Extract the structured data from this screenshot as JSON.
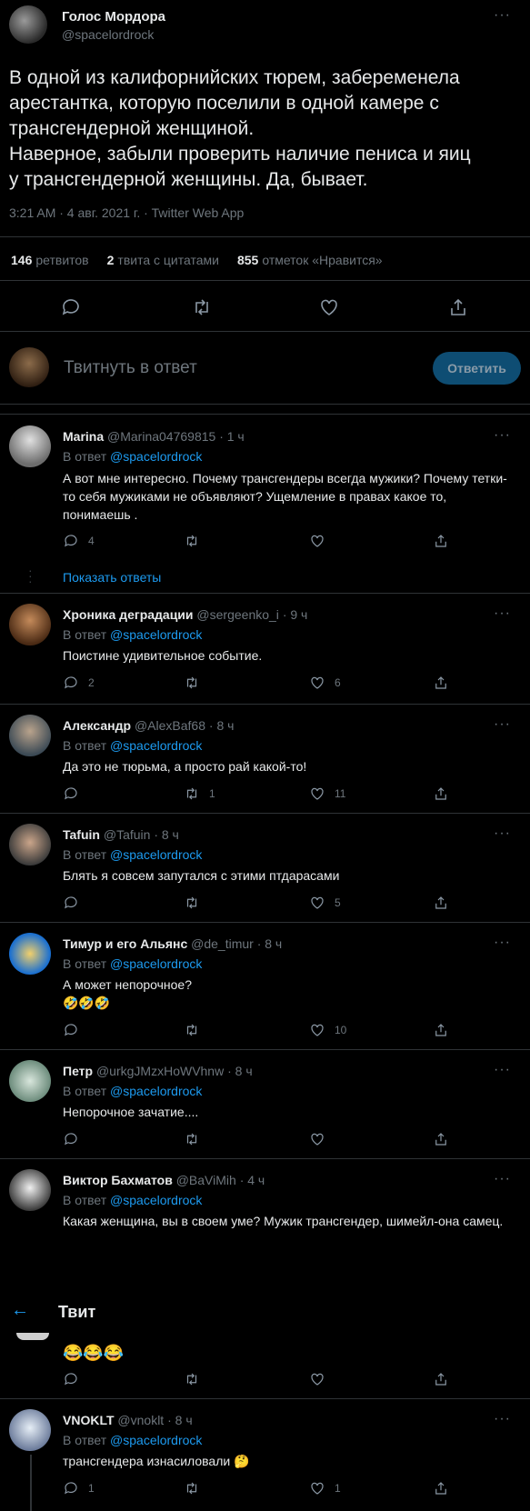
{
  "main_tweet": {
    "name": "Голос Мордора",
    "handle": "@spacelordrock",
    "more": "···",
    "text_lines": [
      "В одной из калифорнийских тюрем, забеременела",
      "арестантка, которую поселили в одной камере с",
      "трансгендерной женщиной.",
      "Наверное, забыли проверить наличие пениса и яиц",
      "у трансгендерной женщины. Да, бывает."
    ],
    "meta": "3:21 AM · 4 авг. 2021 г. · Twitter Web App",
    "stats": [
      {
        "count": "146",
        "label": "ретвитов"
      },
      {
        "count": "2",
        "label": "твита с цитатами"
      },
      {
        "count": "855",
        "label": "отметок «Нравится»"
      }
    ]
  },
  "reply_box": {
    "placeholder": "Твитнуть в ответ",
    "button": "Ответить"
  },
  "header": {
    "back_icon": "arrow-left-icon",
    "title": "Твит"
  },
  "replies": [
    {
      "name": "Marina",
      "handle": "@Marina04769815",
      "time": "· 1 ч",
      "in_reply_prefix": "В ответ",
      "in_reply_to": "@spacelordrock",
      "text": "А вот мне интересно. Почему трансгендеры всегда мужики? Почему тетки-то себя мужиками не объявляют? Ущемление в правах какое то, понимаешь .",
      "replies": "4",
      "retweets": "",
      "likes": "",
      "show_replies": "Показать ответы"
    },
    {
      "name": "Хроника деградации",
      "handle": "@sergeenko_i",
      "time": "· 9 ч",
      "in_reply_prefix": "В ответ",
      "in_reply_to": "@spacelordrock",
      "text": "Поистине удивительное событие.",
      "replies": "2",
      "retweets": "",
      "likes": "6"
    },
    {
      "name": "Александр",
      "handle": "@AlexBaf68",
      "time": "· 8 ч",
      "in_reply_prefix": "В ответ",
      "in_reply_to": "@spacelordrock",
      "text": "Да это не тюрьма, а просто рай какой-то!",
      "replies": "",
      "retweets": "1",
      "likes": "11"
    },
    {
      "name": "Tafuin",
      "handle": "@Tafuin",
      "time": "· 8 ч",
      "in_reply_prefix": "В ответ",
      "in_reply_to": "@spacelordrock",
      "text": "Блять я совсем запутался с этими птдарасами",
      "replies": "",
      "retweets": "",
      "likes": "5"
    },
    {
      "name": "Тимур и его Альянс",
      "handle": "@de_timur",
      "time": "· 8 ч",
      "in_reply_prefix": "В ответ",
      "in_reply_to": "@spacelordrock",
      "text": "А может непорочное?",
      "emoji": "🤣🤣🤣",
      "replies": "",
      "retweets": "",
      "likes": "10"
    },
    {
      "name": "Петр",
      "handle": "@urkgJMzxHoWVhnw",
      "time": "· 8 ч",
      "in_reply_prefix": "В ответ",
      "in_reply_to": "@spacelordrock",
      "text": "Непорочное зачатие....",
      "replies": "",
      "retweets": "",
      "likes": ""
    },
    {
      "name": "Виктор Бахматов",
      "handle": "@BaViMih",
      "time": "· 4 ч",
      "in_reply_prefix": "В ответ",
      "in_reply_to": "@spacelordrock",
      "text": "Какая женщина, вы в своем уме? Мужик трансгендер, шимейл-она самец."
    },
    {
      "partial_emoji": "😂😂😂",
      "replies": "",
      "retweets": "",
      "likes": ""
    },
    {
      "name": "VNOKLT",
      "handle": "@vnoklt",
      "time": "· 8 ч",
      "in_reply_prefix": "В ответ",
      "in_reply_to": "@spacelordrock",
      "text": "трансгендера изнасиловали",
      "emoji": "🤔",
      "replies": "1",
      "retweets": "",
      "likes": "1"
    }
  ]
}
